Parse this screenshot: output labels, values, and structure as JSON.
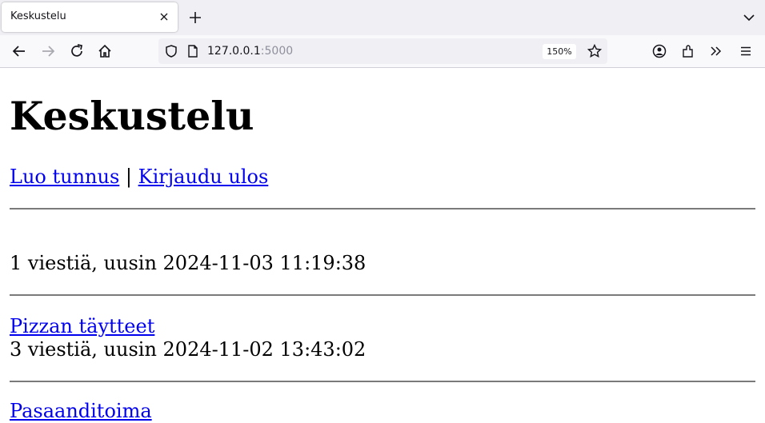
{
  "browser": {
    "tab_title": "Keskustelu",
    "url_host": "127.0.0.1",
    "url_port": ":5000",
    "zoom": "150%"
  },
  "page": {
    "title": "Keskustelu",
    "nav_links": {
      "register": "Luo tunnus",
      "separator": "|",
      "logout": "Kirjaudu ulos"
    },
    "topics": [
      {
        "title": "",
        "meta": "1 viestiä, uusin 2024-11-03 11:19:38"
      },
      {
        "title": "Pizzan täytteet",
        "meta": "3 viestiä, uusin 2024-11-02 13:43:02"
      },
      {
        "title": "Pasaanditoima"
      }
    ]
  }
}
